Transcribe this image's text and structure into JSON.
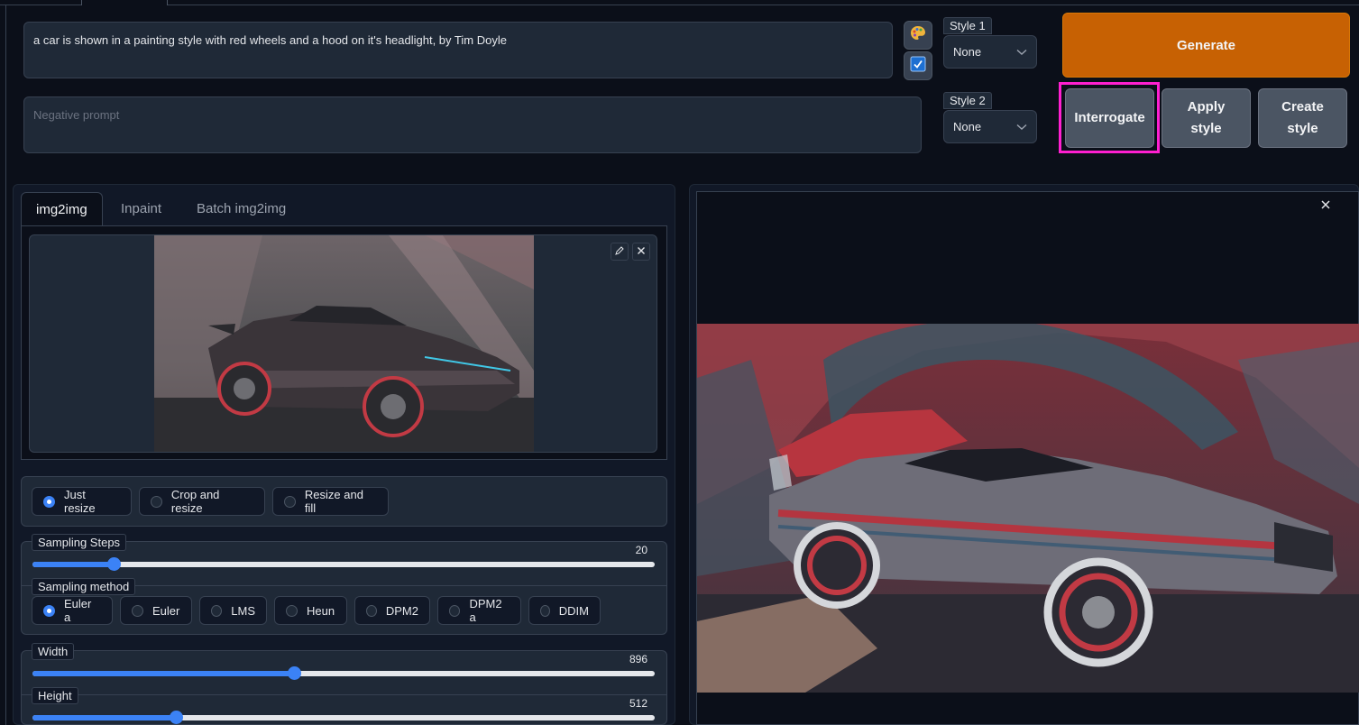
{
  "prompt": {
    "value": "a car is shown in a painting style with red wheels and a hood on it's headlight, by Tim Doyle",
    "negative_placeholder": "Negative prompt"
  },
  "icons": {
    "palette": "palette-icon",
    "checkbox": "checkbox-icon"
  },
  "styles": {
    "style1_label": "Style 1",
    "style1_value": "None",
    "style2_label": "Style 2",
    "style2_value": "None"
  },
  "actions": {
    "generate": "Generate",
    "interrogate": "Interrogate",
    "apply_style": "Apply style",
    "create_style": "Create style"
  },
  "tabs": [
    {
      "label": "img2img",
      "active": true
    },
    {
      "label": "Inpaint",
      "active": false
    },
    {
      "label": "Batch img2img",
      "active": false
    }
  ],
  "resize_mode": {
    "options": [
      "Just resize",
      "Crop and resize",
      "Resize and fill"
    ],
    "selected": "Just resize"
  },
  "sampling_steps": {
    "label": "Sampling Steps",
    "value": "20",
    "fraction": 0.13
  },
  "sampling_method": {
    "label": "Sampling method",
    "options": [
      "Euler a",
      "Euler",
      "LMS",
      "Heun",
      "DPM2",
      "DPM2 a",
      "DDIM"
    ],
    "selected": "Euler a"
  },
  "width": {
    "label": "Width",
    "value": "896",
    "fraction": 0.42
  },
  "height": {
    "label": "Height",
    "value": "512",
    "fraction": 0.23
  },
  "colors": {
    "accent": "#3b82f6",
    "generate": "#c76103",
    "highlight": "#ff1fd0",
    "background": "#0b0f19"
  }
}
